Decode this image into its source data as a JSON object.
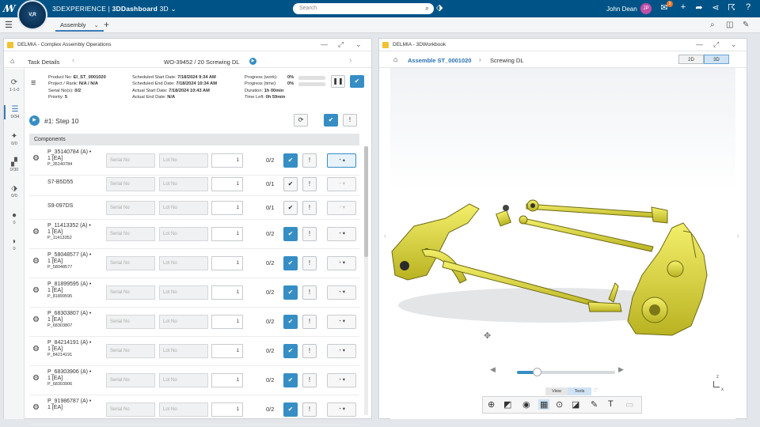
{
  "app": {
    "brand_prefix": "3DEXPERIENCE | ",
    "brand_app": "3DDashboard",
    "brand_suffix": " 3D",
    "compass_label": "V,R",
    "search_placeholder": "Search",
    "user": "John Dean",
    "avatar_initials": "JP",
    "notif_count": "3"
  },
  "tabs": {
    "active": "Assembly"
  },
  "left_panel": {
    "title": "DELMIA - Complex Assembly Operations",
    "crumb": "Task Details",
    "work_order": "WO-39452 / 20 Screwing DL",
    "sidebar": [
      {
        "count": "1-1-0",
        "icon": "refresh-icon"
      },
      {
        "count": "0/34",
        "icon": "list-icon"
      },
      {
        "count": "0/0",
        "icon": "wrench-icon"
      },
      {
        "count": "0/30",
        "icon": "parts-icon"
      },
      {
        "count": "0/0",
        "icon": "tag-icon"
      },
      {
        "count": "0",
        "icon": "alert-icon"
      },
      {
        "count": "0",
        "icon": "comment-icon"
      }
    ],
    "info": {
      "product_no_label": "Product No:",
      "product_no": "EI_ST_0001020",
      "project_label": "Project / Rank:",
      "project": "N/A / N/A",
      "serial_label": "Serial No(s):",
      "serial": "0/2",
      "priority_label": "Priority:",
      "priority": "5",
      "sched_start_label": "Scheduled Start Date:",
      "sched_start": "7/18/2024 9:34 AM",
      "sched_end_label": "Scheduled End Date:",
      "sched_end": "7/18/2024 10:34 AM",
      "actual_start_label": "Actual Start Date:",
      "actual_start": "7/18/2024 10:43 AM",
      "actual_end_label": "Actual End Date:",
      "actual_end": "N/A",
      "prog_work_label": "Progress (work):",
      "prog_work": "0%",
      "prog_time_label": "Progress (time):",
      "prog_time": "0%",
      "duration_label": "Duration:",
      "duration": "1h 00min",
      "time_left_label": "Time Left:",
      "time_left": "0h 59min"
    },
    "step": "#1: Step 10",
    "components_header": "Components",
    "serial_placeholder": "Serial No",
    "lot_placeholder": "Lot No",
    "components": [
      {
        "name": "P_35140784 (A) •",
        "qty_line": "1 [EA]",
        "sub": "P_35140784",
        "qty": "1",
        "count": "0/2",
        "state": "open"
      },
      {
        "name": "S7-B5D55",
        "qty_line": "",
        "sub": "",
        "qty": "1",
        "count": "0/1",
        "state": "sub"
      },
      {
        "name": "S9-097DS",
        "qty_line": "",
        "sub": "",
        "qty": "1",
        "count": "0/1",
        "state": "sub"
      },
      {
        "name": "P_11413352 (A) •",
        "qty_line": "1 [EA]",
        "sub": "P_11413352",
        "qty": "1",
        "count": "0/2",
        "state": "closed"
      },
      {
        "name": "P_58048577 (A) •",
        "qty_line": "1 [EA]",
        "sub": "P_58048577",
        "qty": "1",
        "count": "0/2",
        "state": "closed"
      },
      {
        "name": "P_81899595 (A) •",
        "qty_line": "1 [EA]",
        "sub": "P_81899595",
        "qty": "1",
        "count": "0/2",
        "state": "closed"
      },
      {
        "name": "P_68303807 (A) •",
        "qty_line": "1 [EA]",
        "sub": "P_68303807",
        "qty": "1",
        "count": "0/2",
        "state": "closed"
      },
      {
        "name": "P_84214191 (A) •",
        "qty_line": "1 [EA]",
        "sub": "P_84214191",
        "qty": "1",
        "count": "0/2",
        "state": "closed"
      },
      {
        "name": "P_68303906 (A) •",
        "qty_line": "1 [EA]",
        "sub": "P_68303906",
        "qty": "1",
        "count": "0/2",
        "state": "closed"
      },
      {
        "name": "P_91986787 (A) •",
        "qty_line": "1 [EA]",
        "sub": "",
        "qty": "1",
        "count": "0/2",
        "state": "closed"
      }
    ]
  },
  "right_panel": {
    "title": "DELMIA - 3DWorkbook",
    "crumb_link": "Assemble ST_0001020",
    "crumb_current": "Screwing DL",
    "mode_2d": "2D",
    "mode_3d": "3D",
    "tab_view": "View",
    "tab_tools": "Tools",
    "axis_z": "z",
    "axis_x": "x"
  },
  "colors": {
    "accent": "#368ec4",
    "topbar": "#005386",
    "part": "#e5e034"
  }
}
